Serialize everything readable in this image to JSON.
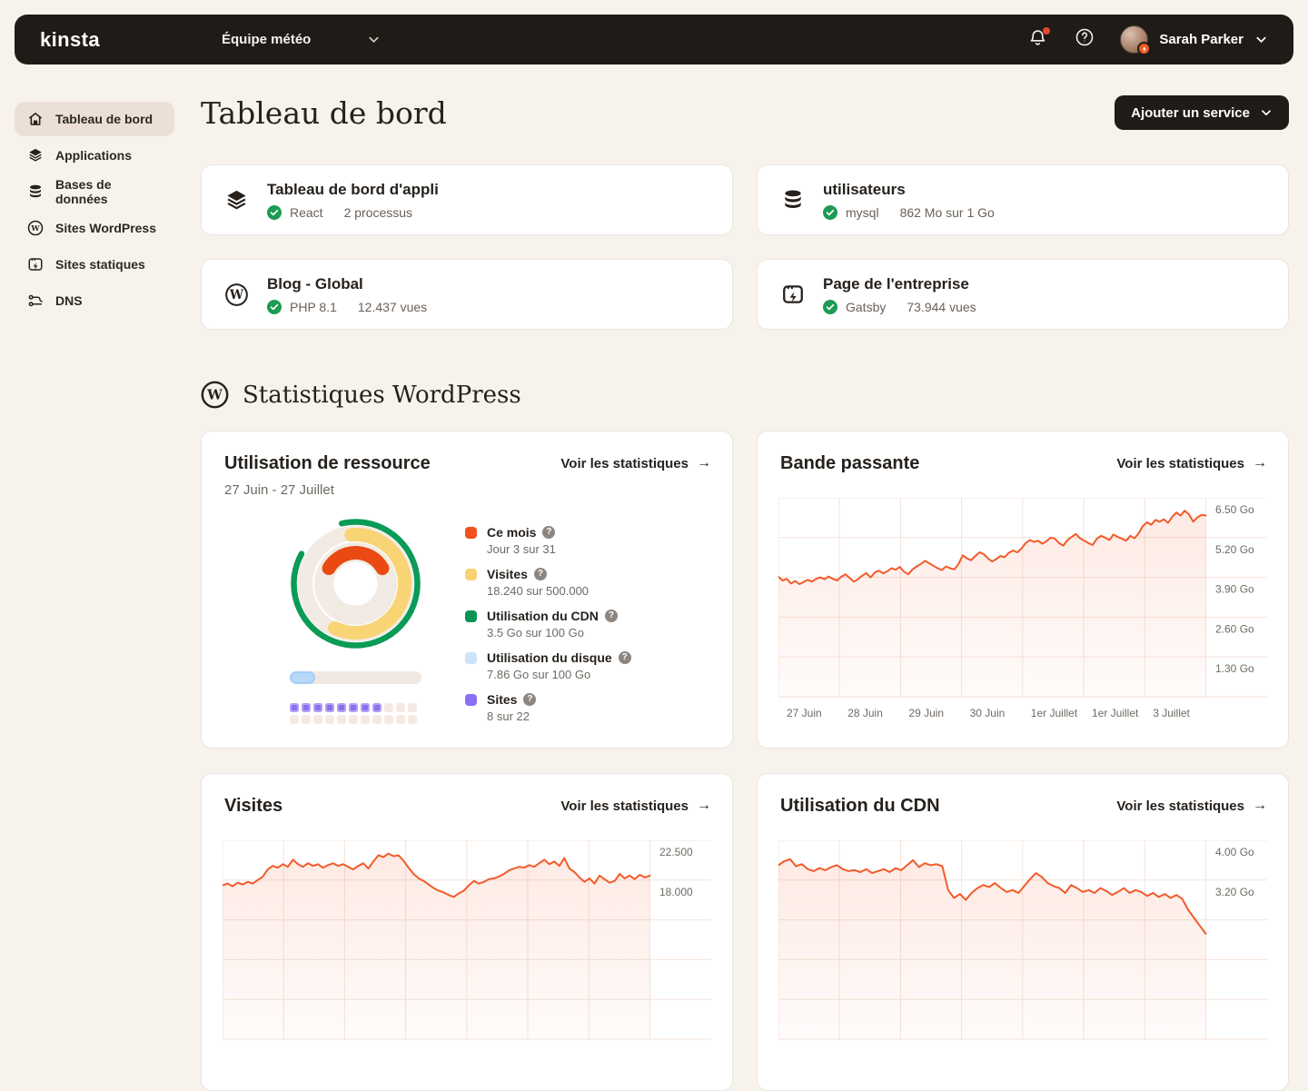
{
  "navbar": {
    "logo": "kinsta",
    "team_selector": "Équipe météo",
    "user_name": "Sarah Parker"
  },
  "sidebar": {
    "items": [
      {
        "label": "Tableau de bord",
        "icon": "home",
        "active": true
      },
      {
        "label": "Applications",
        "icon": "stack",
        "active": false
      },
      {
        "label": "Bases de données",
        "icon": "database",
        "active": false
      },
      {
        "label": "Sites WordPress",
        "icon": "wordpress",
        "active": false
      },
      {
        "label": "Sites statiques",
        "icon": "static-site",
        "active": false
      },
      {
        "label": "DNS",
        "icon": "dns",
        "active": false
      }
    ]
  },
  "header": {
    "title": "Tableau de bord",
    "add_service_label": "Ajouter un service"
  },
  "service_cards": [
    {
      "title": "Tableau de bord d'appli",
      "icon": "stack",
      "tech": "React",
      "meta": "2 processus"
    },
    {
      "title": "utilisateurs",
      "icon": "database",
      "tech": "mysql",
      "meta": "862 Mo sur 1 Go"
    },
    {
      "title": "Blog - Global",
      "icon": "wordpress",
      "tech": "PHP 8.1",
      "meta": "12.437 vues"
    },
    {
      "title": "Page de l'entreprise",
      "icon": "static-site",
      "tech": "Gatsby",
      "meta": "73.944 vues"
    }
  ],
  "stats_section": {
    "title": "Statistiques WordPress",
    "view_stats_label": "Voir les statistiques"
  },
  "resource_card": {
    "title": "Utilisation de ressource",
    "date_range": "27 Juin - 27 Juillet",
    "sites_used": 8,
    "sites_total": 22,
    "legend": [
      {
        "label": "Ce mois",
        "value": "Jour 3 sur 31",
        "color": "#f0511d"
      },
      {
        "label": "Visites",
        "value": "18.240 sur 500.000",
        "color": "#f8d272"
      },
      {
        "label": "Utilisation du CDN",
        "value": "3.5 Go sur 100 Go",
        "color": "#079455"
      },
      {
        "label": "Utilisation du disque",
        "value": "7.86 Go sur 100 Go",
        "color": "#cde3fa"
      },
      {
        "label": "Sites",
        "value": "8 sur 22",
        "color": "#8a70f0"
      }
    ]
  },
  "colors": {
    "accent_orange": "#f15b2a",
    "grid": "#f4e3da",
    "green": "#0a9b57",
    "dark": "#201b16",
    "muted": "#6f6963"
  },
  "chart_data": [
    {
      "id": "bandwidth",
      "type": "line",
      "title": "Bande passante",
      "ylabel": "Go",
      "y_top": 6.5,
      "y_step": 1.3,
      "ylim": [
        0,
        6.5
      ],
      "grid": true,
      "y_ticks": [
        {
          "label": "6.50 Go",
          "value": 6.5
        },
        {
          "label": "5.20 Go",
          "value": 5.2
        },
        {
          "label": "3.90 Go",
          "value": 3.9
        },
        {
          "label": "2.60 Go",
          "value": 2.6
        },
        {
          "label": "1.30 Go",
          "value": 1.3
        }
      ],
      "x_labels": [
        "27 Juin",
        "28 Juin",
        "29 Juin",
        "30 Juin",
        "1er Juillet",
        "1er Juillet",
        "3 Juillet"
      ],
      "values": [
        3.92,
        3.8,
        3.85,
        3.7,
        3.78,
        3.68,
        3.75,
        3.82,
        3.76,
        3.85,
        3.9,
        3.84,
        3.93,
        3.85,
        3.8,
        3.92,
        4.0,
        3.88,
        3.76,
        3.84,
        3.96,
        4.04,
        3.9,
        4.06,
        4.12,
        4.03,
        4.1,
        4.2,
        4.15,
        4.24,
        4.08,
        4.0,
        4.16,
        4.26,
        4.34,
        4.44,
        4.36,
        4.28,
        4.2,
        4.14,
        4.26,
        4.2,
        4.16,
        4.34,
        4.62,
        4.52,
        4.46,
        4.6,
        4.72,
        4.66,
        4.52,
        4.42,
        4.5,
        4.6,
        4.56,
        4.7,
        4.78,
        4.72,
        4.84,
        5.02,
        5.12,
        5.06,
        5.1,
        5.0,
        5.08,
        5.2,
        5.16,
        5.02,
        4.94,
        5.12,
        5.22,
        5.32,
        5.18,
        5.1,
        5.02,
        4.96,
        5.16,
        5.26,
        5.2,
        5.12,
        5.3,
        5.22,
        5.16,
        5.1,
        5.26,
        5.18,
        5.34,
        5.58,
        5.7,
        5.62,
        5.78,
        5.72,
        5.8,
        5.68,
        5.88,
        6.02,
        5.92,
        6.08,
        5.96,
        5.72,
        5.86,
        5.94,
        5.92
      ]
    },
    {
      "id": "visits",
      "type": "line",
      "title": "Visites",
      "y_top": 22.5,
      "y_step": 4.5,
      "grid": true,
      "y_ticks": [
        {
          "label": "22.500",
          "value": 22.5
        },
        {
          "label": "18.000",
          "value": 18.0
        }
      ],
      "x_labels": [],
      "values": [
        17.4,
        17.6,
        17.3,
        17.7,
        17.5,
        17.8,
        17.6,
        18.0,
        18.4,
        19.2,
        19.6,
        19.4,
        19.8,
        19.5,
        20.3,
        19.8,
        19.5,
        19.9,
        19.6,
        19.8,
        19.4,
        19.7,
        19.9,
        19.6,
        19.8,
        19.5,
        19.2,
        19.6,
        19.9,
        19.3,
        20.1,
        20.8,
        20.6,
        21.0,
        20.7,
        20.8,
        20.2,
        19.4,
        18.7,
        18.2,
        17.9,
        17.5,
        17.1,
        16.8,
        16.6,
        16.3,
        16.1,
        16.5,
        16.8,
        17.4,
        17.9,
        17.6,
        17.8,
        18.1,
        18.2,
        18.4,
        18.7,
        19.1,
        19.3,
        19.5,
        19.4,
        19.7,
        19.5,
        19.9,
        20.3,
        19.8,
        20.1,
        19.6,
        20.5,
        19.3,
        18.9,
        18.3,
        17.8,
        18.2,
        17.6,
        18.5,
        18.1,
        17.7,
        17.9,
        18.7,
        18.2,
        18.5,
        18.1,
        18.6,
        18.3,
        18.5
      ]
    },
    {
      "id": "cdn",
      "type": "line",
      "title": "Utilisation du CDN",
      "ylabel": "Go",
      "y_top": 4.0,
      "y_step": 0.8,
      "grid": true,
      "y_ticks": [
        {
          "label": "4.00 Go",
          "value": 4.0
        },
        {
          "label": "3.20 Go",
          "value": 3.2
        }
      ],
      "x_labels": [],
      "values": [
        3.5,
        3.58,
        3.62,
        3.48,
        3.52,
        3.42,
        3.38,
        3.44,
        3.4,
        3.46,
        3.5,
        3.42,
        3.38,
        3.4,
        3.36,
        3.42,
        3.34,
        3.38,
        3.42,
        3.36,
        3.44,
        3.4,
        3.5,
        3.6,
        3.46,
        3.54,
        3.5,
        3.52,
        3.48,
        3.0,
        2.84,
        2.92,
        2.8,
        2.94,
        3.04,
        3.1,
        3.06,
        3.14,
        3.04,
        2.96,
        3.0,
        2.94,
        3.08,
        3.22,
        3.34,
        3.26,
        3.14,
        3.08,
        3.04,
        2.94,
        3.1,
        3.04,
        2.96,
        3.0,
        2.94,
        3.04,
        2.98,
        2.9,
        2.96,
        3.04,
        2.94,
        3.0,
        2.96,
        2.88,
        2.94,
        2.86,
        2.92,
        2.84,
        2.9,
        2.82,
        2.6,
        2.44,
        2.28,
        2.12
      ]
    },
    {
      "type": "donut",
      "title": "Utilisation de ressource",
      "segments": [
        {
          "label": "Ce mois",
          "used": 3,
          "total": 31
        },
        {
          "label": "Visites",
          "used": 18240,
          "total": 500000
        },
        {
          "label": "Utilisation du CDN",
          "used": 3.5,
          "total": 100
        },
        {
          "label": "Utilisation du disque",
          "used": 7.86,
          "total": 100
        },
        {
          "label": "Sites",
          "used": 8,
          "total": 22
        }
      ]
    }
  ]
}
